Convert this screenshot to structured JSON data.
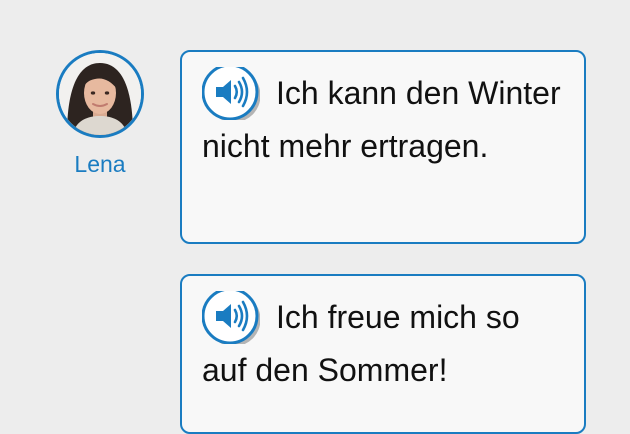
{
  "speaker": {
    "name": "Lena"
  },
  "messages": [
    {
      "text": "Ich kann den Winter nicht mehr ertragen."
    },
    {
      "text": "Ich freue mich so auf den Sommer!"
    }
  ],
  "icons": {
    "audio": "speaker-volume-icon"
  },
  "colors": {
    "accent": "#1a7cc1",
    "background": "#ededed",
    "bubble": "#f8f8f8",
    "text": "#111111"
  }
}
